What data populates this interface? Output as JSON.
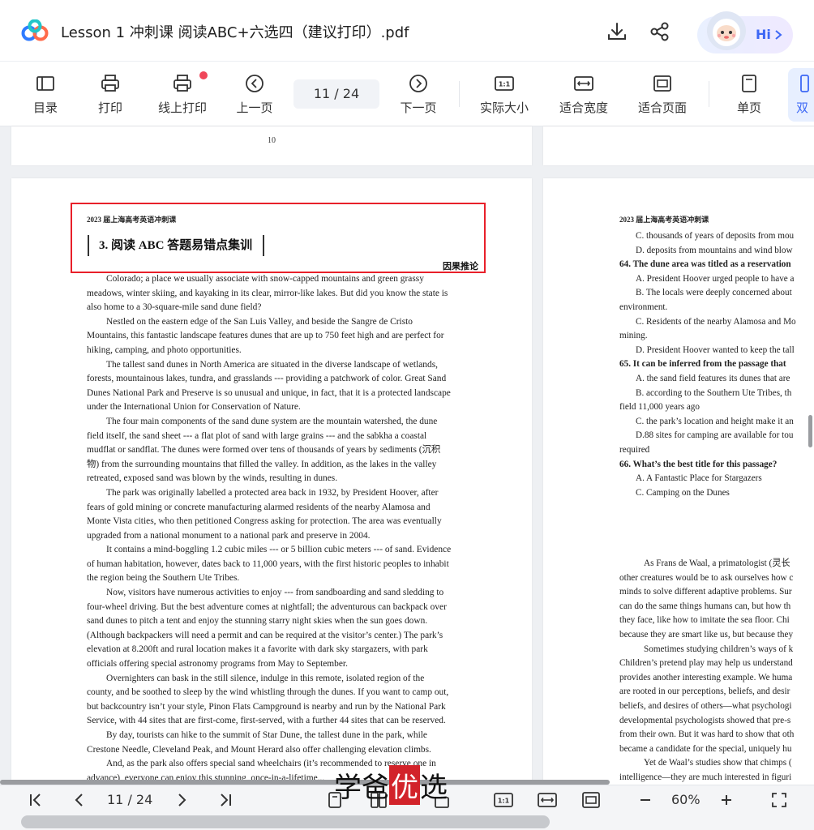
{
  "window": {
    "title": "Lesson 1 冲刺课 阅读ABC+六选四（建议打印）.pdf",
    "assistant_label": "Hi",
    "icons": {
      "download": "download-icon",
      "share": "share-icon",
      "chevron": "chevron-right-icon"
    }
  },
  "toolbar": {
    "items": [
      {
        "label": "目录",
        "icon": "toc-icon"
      },
      {
        "label": "打印",
        "icon": "printer-icon"
      },
      {
        "label": "线上打印",
        "icon": "online-print-icon"
      },
      {
        "label": "上一页",
        "icon": "prev-page-icon"
      },
      {
        "label": "下一页",
        "icon": "next-page-icon"
      },
      {
        "label": "实际大小",
        "icon": "actual-size-icon"
      },
      {
        "label": "适合宽度",
        "icon": "fit-width-icon"
      },
      {
        "label": "适合页面",
        "icon": "fit-page-icon"
      },
      {
        "label": "单页",
        "icon": "single-page-icon"
      },
      {
        "label": "双",
        "icon": "double-page-icon"
      }
    ],
    "page_indicator": "11 / 24"
  },
  "prev_page": {
    "page_number": "10"
  },
  "left_page": {
    "header": "2023 届上海高考英语冲刺课",
    "section_title": "3. 阅读 ABC 答题易错点集训",
    "author": "因果推论",
    "lines": [
      "Colorado; a place we usually associate with snow-capped mountains and green grassy",
      "meadows, winter skiing, and kayaking in its clear, mirror-like lakes. But did you know the state is",
      "also home to a 30-square-mile sand dune  field?",
      "Nestled on the eastern edge of the San Luis Valley, and beside the Sangre de Cristo",
      "Mountains, this fantastic landscape features dunes that are up to 750 feet high and are perfect for",
      "hiking, camping, and photo opportunities.",
      "The tallest sand dunes in North America are situated in the diverse landscape of wetlands,",
      "forests, mountainous lakes, tundra, and grasslands --- providing a patchwork of color. Great Sand",
      "Dunes National Park and Preserve is so unusual and unique, in fact, that it is a protected landscape",
      "under the International Union for Conservation of Nature.",
      "The four main components of the sand dune system are the mountain watershed, the dune",
      "field itself, the sand sheet --- a flat plot of sand with large grains --- and the sabkha a coastal",
      "mudflat or sandflat. The dunes were formed over tens of thousands of years by sediments (沉积",
      "物) from the surrounding mountains that filled the valley. In addition, as the lakes in the valley",
      "retreated, exposed sand was blown by the winds, resulting in dunes.",
      "The park was originally labelled a protected area back in 1932, by President Hoover, after",
      "fears of gold mining or concrete manufacturing alarmed residents of the nearby Alamosa and",
      "Monte Vista cities, who then petitioned  Congress asking for protection. The area was eventually",
      "upgraded from a national monument to a national park and preserve in 2004.",
      "It contains a mind-boggling 1.2 cubic miles --- or 5 billion cubic meters --- of sand. Evidence",
      "of human habitation, however, dates back to 11,000 years, with the first historic peoples to inhabit",
      "the region being the Southern Ute Tribes.",
      "Now, visitors have numerous activities to enjoy --- from sandboarding and sand sledding to",
      "four-wheel driving. But the best adventure comes at nightfall; the adventurous can backpack over",
      "sand dunes to pitch a tent and enjoy the stunning starry night skies when the sun goes down.",
      "(Although backpackers will need a permit and can be required at the visitor’s center.) The park’s",
      "elevation at 8.200ft and rural location makes it a favorite with dark sky stargazers, with park",
      "officials offering special astronomy programs from May to September.",
      "Overnighters can bask in the still silence, indulge in this remote, isolated region of the",
      "county, and be soothed to sleep by the wind whistling through the dunes. If you want to camp out,",
      "but backcountry isn’t your style, Pinon Flats Campground is nearby and run by the National Park",
      "Service, with 44 sites that are first-come, first-served, with a further 44 sites that can be reserved.",
      "By day, tourists can hike to the summit of Star Dune, the tallest dune in the park, while",
      "Crestone Needle, Cleveland Peak, and Mount Herard also offer challenging elevation climbs.",
      "And, as the park also offers special sand wheelchairs (it’s recommended to reserve one in",
      "advance), everyone can enjoy this stunning, once-in-a-lifetime..."
    ],
    "indented_lines": [
      0,
      3,
      6,
      10,
      15,
      19,
      22,
      28,
      32,
      34
    ]
  },
  "right_page": {
    "header": "2023 届上海高考英语冲刺课",
    "lines": [
      {
        "t": "C. thousands of years of deposits from mou",
        "s": "ind"
      },
      {
        "t": "D. deposits from mountains and wind blow",
        "s": "ind"
      },
      {
        "t": "64. The dune area was titled as a reservation",
        "s": "q"
      },
      {
        "t": "A. President Hoover urged people to have a",
        "s": "ind"
      },
      {
        "t": "B. The locals were deeply concerned about",
        "s": "ind"
      },
      {
        "t": "environment.",
        "s": ""
      },
      {
        "t": "C. Residents of the nearby Alamosa and Mo",
        "s": "ind"
      },
      {
        "t": "mining.",
        "s": ""
      },
      {
        "t": "D. President Hoover wanted to keep the tall",
        "s": "ind"
      },
      {
        "t": "65. It can be inferred from the passage that",
        "s": "q"
      },
      {
        "t": "A. the sand field features its dunes that are",
        "s": "ind"
      },
      {
        "t": "B. according to the Southern Ute Tribes, th",
        "s": "ind"
      },
      {
        "t": "field 11,000 years ago",
        "s": ""
      },
      {
        "t": "C. the park’s location and height make it an",
        "s": "ind"
      },
      {
        "t": "D.88 sites for camping are available for tou",
        "s": "ind"
      },
      {
        "t": "required",
        "s": ""
      },
      {
        "t": "66. What’s the best title for this passage?",
        "s": "q"
      },
      {
        "t": "A. A Fantastic Place for Stargazers",
        "s": "ind"
      },
      {
        "t": "C. Camping on the Dunes",
        "s": "ind"
      }
    ],
    "lines2": [
      {
        "t": "As Frans de Waal, a primatologist (灵长",
        "s": "ind"
      },
      {
        "t": "other creatures would be to ask ourselves how c",
        "s": ""
      },
      {
        "t": "minds to solve different adaptive problems. Sur",
        "s": ""
      },
      {
        "t": "can do the same things humans can, but how th",
        "s": ""
      },
      {
        "t": "they face, like how to imitate the sea floor. Chi",
        "s": ""
      },
      {
        "t": "because they are smart like us, but because they",
        "s": ""
      },
      {
        "t": "Sometimes studying children’s ways of k",
        "s": "ind"
      },
      {
        "t": "Children’s pretend play may help us understand",
        "s": ""
      },
      {
        "t": "provides another interesting example. We huma",
        "s": ""
      },
      {
        "t": "are rooted in our perceptions, beliefs, and desir",
        "s": ""
      },
      {
        "t": "beliefs, and desires of others—what psychologi",
        "s": ""
      },
      {
        "t": "developmental psychologists showed that pre-s",
        "s": ""
      },
      {
        "t": "from their own. But it was hard to show that oth",
        "s": ""
      },
      {
        "t": "became a candidate for the special, uniquely hu",
        "s": ""
      },
      {
        "t": "Yet de Waal’s studies show that chimps (",
        "s": "ind"
      },
      {
        "t": "intelligence—they are much interested in figuri",
        "s": ""
      }
    ]
  },
  "bottom_bar": {
    "page_indicator": "11 / 24",
    "zoom": "60%"
  },
  "watermark": {
    "part1": "学爸",
    "part2": "优",
    "part3": "选"
  }
}
